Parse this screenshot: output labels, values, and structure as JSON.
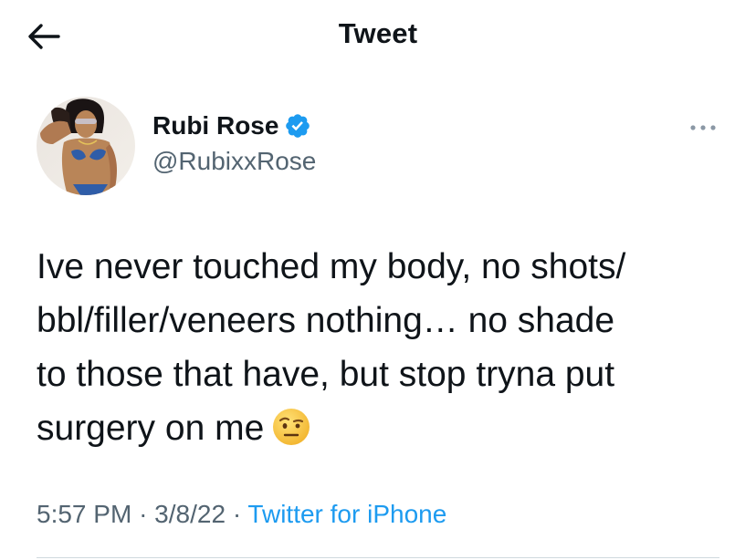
{
  "header": {
    "title": "Tweet",
    "back_icon": "arrow-left-icon"
  },
  "tweet": {
    "author": {
      "name": "Rubi Rose",
      "handle": "@RubixxRose",
      "verified": true,
      "verified_icon": "verified-badge-icon",
      "avatar_icon": "avatar-photo"
    },
    "more_icon": "more-horizontal-icon",
    "text_lines": [
      "Ive never touched my body, no shots/",
      "bbl/filler/veneers nothing… no shade",
      "to those that have, but stop tryna put",
      "surgery on me"
    ],
    "emoji": "face-with-raised-eyebrow-emoji",
    "time": "5:57 PM",
    "separator": "·",
    "date": "3/8/22",
    "source": "Twitter for iPhone"
  },
  "colors": {
    "text_primary": "#0f1419",
    "text_secondary": "#536471",
    "accent": "#1d9bf0",
    "divider": "#cfd9de"
  }
}
